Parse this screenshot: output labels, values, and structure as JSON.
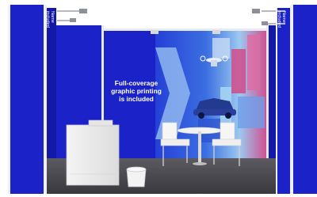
{
  "callout": {
    "lines": [
      "Full-coverage",
      "graphic printing",
      "is included"
    ]
  },
  "fascia": {
    "left": [
      "Name",
      "included"
    ],
    "right": [
      "Name",
      "included"
    ]
  },
  "colors": {
    "panel_blue": "#1b22c7",
    "panel_blue_dark": "#1219a6",
    "frame_white": "#f2f3f6",
    "floor": "#4a4a4f",
    "graphic_light_blue": "#9fc9ef",
    "graphic_magenta": "#cf3f86"
  },
  "objects": [
    "counter",
    "bin",
    "table",
    "chairs",
    "spotlights",
    "car-graphic"
  ]
}
